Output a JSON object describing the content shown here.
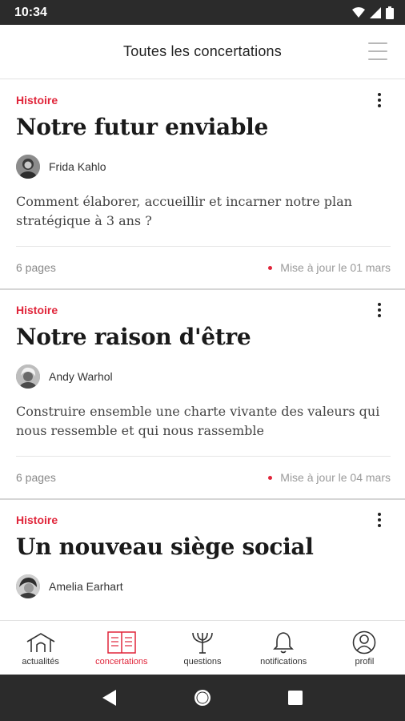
{
  "status_bar": {
    "time": "10:34",
    "icons": [
      "wifi-icon",
      "signal-icon",
      "battery-icon"
    ]
  },
  "header": {
    "title": "Toutes les concertations",
    "menu_icon": "hamburger-icon"
  },
  "cards": [
    {
      "category": "Histoire",
      "title": "Notre futur enviable",
      "author": "Frida Kahlo",
      "description": "Comment élaborer, accueillir et incarner notre plan stratégique à 3 ans ?",
      "pages": "6 pages",
      "updated": "Mise à jour le 01 mars"
    },
    {
      "category": "Histoire",
      "title": "Notre raison d'être",
      "author": "Andy Warhol",
      "description": "Construire ensemble une charte vivante des valeurs qui nous ressemble et qui nous rassemble",
      "pages": "6 pages",
      "updated": "Mise à jour le 04 mars"
    },
    {
      "category": "Histoire",
      "title": "Un nouveau siège social",
      "author": "Amelia Earhart",
      "description": "",
      "pages": "",
      "updated": ""
    }
  ],
  "bottom_nav": [
    {
      "label": "actualités",
      "icon": "home-icon",
      "active": false
    },
    {
      "label": "concertations",
      "icon": "book-icon",
      "active": true
    },
    {
      "label": "questions",
      "icon": "trident-icon",
      "active": false
    },
    {
      "label": "notifications",
      "icon": "bell-icon",
      "active": false
    },
    {
      "label": "profil",
      "icon": "user-icon",
      "active": false
    }
  ],
  "colors": {
    "accent": "#e0253a",
    "status_bar": "#2b2b2b",
    "text": "#1a1a1a"
  }
}
